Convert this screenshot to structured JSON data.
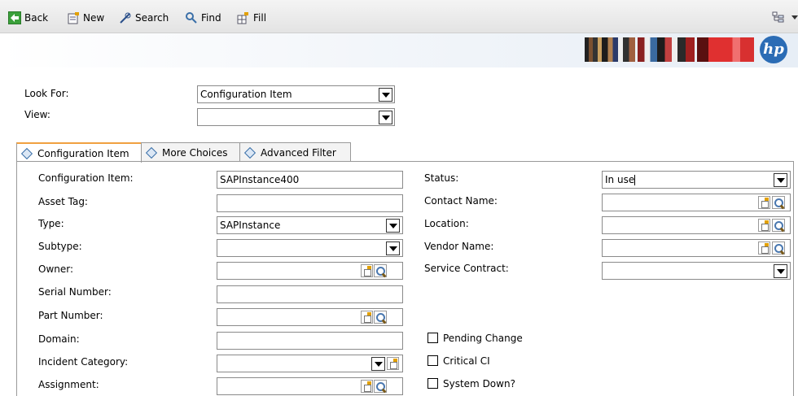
{
  "toolbar": {
    "back": "Back",
    "new": "New",
    "search": "Search",
    "find": "Find",
    "fill": "Fill"
  },
  "brand": {
    "logo_text": "hp"
  },
  "lookfor": {
    "look_for_label": "Look For:",
    "look_for_value": "Configuration Item",
    "view_label": "View:",
    "view_value": ""
  },
  "tabs": [
    {
      "label": "Configuration Item",
      "active": true
    },
    {
      "label": "More Choices",
      "active": false
    },
    {
      "label": "Advanced Filter",
      "active": false
    }
  ],
  "form": {
    "configuration_item": {
      "label": "Configuration Item:",
      "value": "SAPInstance400"
    },
    "asset_tag": {
      "label": "Asset Tag:",
      "value": ""
    },
    "type": {
      "label": "Type:",
      "value": "SAPInstance"
    },
    "subtype": {
      "label": "Subtype:",
      "value": ""
    },
    "owner": {
      "label": "Owner:",
      "value": ""
    },
    "serial_number": {
      "label": "Serial Number:",
      "value": ""
    },
    "part_number": {
      "label": "Part Number:",
      "value": ""
    },
    "domain": {
      "label": "Domain:",
      "value": ""
    },
    "incident_category": {
      "label": "Incident Category:",
      "value": ""
    },
    "assignment": {
      "label": "Assignment:",
      "value": ""
    },
    "status": {
      "label": "Status:",
      "value": "In use"
    },
    "contact_name": {
      "label": "Contact Name:",
      "value": ""
    },
    "location": {
      "label": "Location:",
      "value": ""
    },
    "vendor_name": {
      "label": "Vendor Name:",
      "value": ""
    },
    "service_contract": {
      "label": "Service Contract:",
      "value": ""
    },
    "pending_change": {
      "label": "Pending Change",
      "checked": false
    },
    "critical_ci": {
      "label": "Critical CI",
      "checked": false
    },
    "system_down": {
      "label": "System Down?",
      "checked": false
    }
  },
  "colors": {
    "accent_tab": "#f0a040",
    "hp_blue": "#2b6cb5",
    "back_green": "#3aa03a"
  }
}
